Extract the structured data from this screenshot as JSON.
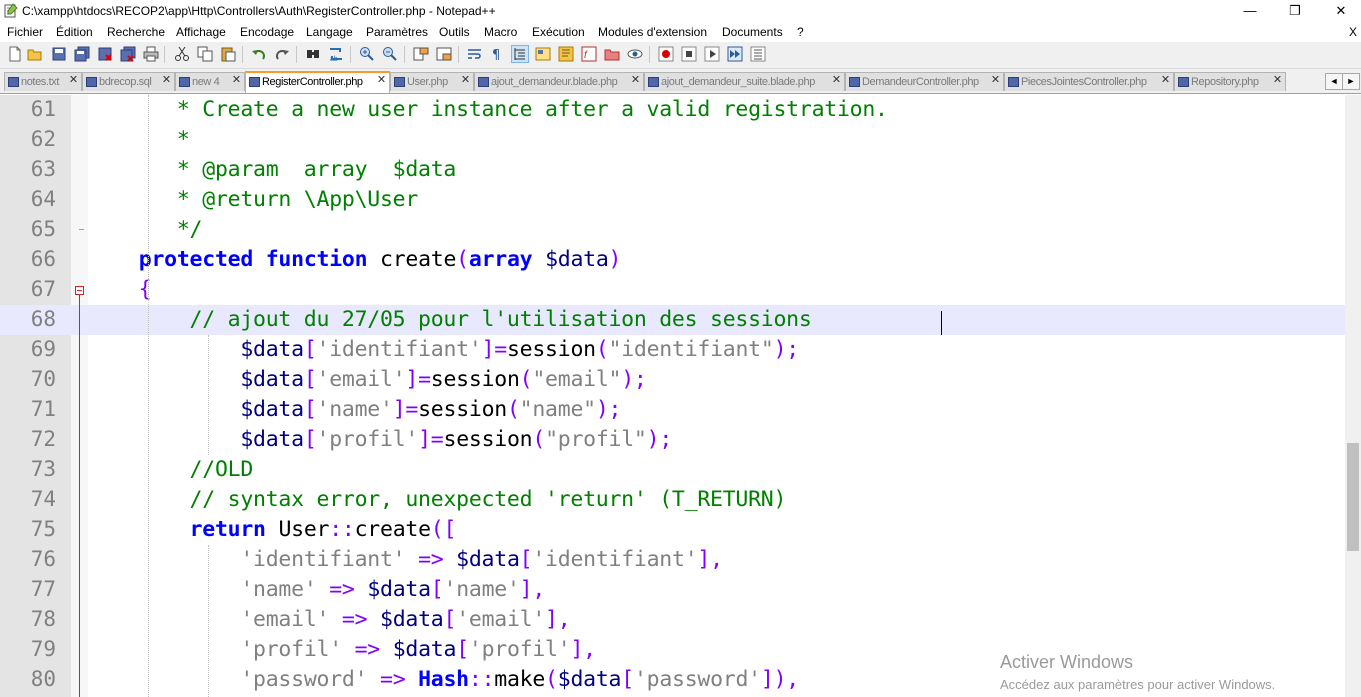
{
  "window": {
    "title": "C:\\xampp\\htdocs\\RECOP2\\app\\Http\\Controllers\\Auth\\RegisterController.php - Notepad++",
    "minimize": "—",
    "maximize": "❐",
    "close": "✕"
  },
  "menu": {
    "items": [
      "Fichier",
      "Édition",
      "Recherche",
      "Affichage",
      "Encodage",
      "Langage",
      "Paramètres",
      "Outils",
      "Macro",
      "Exécution",
      "Modules d'extension",
      "Documents",
      "?"
    ],
    "close_doc": "X"
  },
  "toolbar": {
    "icons": [
      "new-file-icon",
      "open-file-icon",
      "save-icon",
      "save-all-icon",
      "close-icon",
      "close-all-icon",
      "print-icon",
      "cut-icon",
      "copy-icon",
      "paste-icon",
      "undo-icon",
      "redo-icon",
      "find-icon",
      "replace-icon",
      "zoom-in-icon",
      "zoom-out-icon",
      "sync-vertical-icon",
      "sync-horizontal-icon",
      "word-wrap-icon",
      "show-all-chars-icon",
      "indent-guide-icon",
      "lang-udl-icon",
      "doc-map-icon",
      "function-list-icon",
      "folder-workspace-icon",
      "monitoring-icon",
      "record-macro-icon",
      "stop-record-icon",
      "play-macro-icon",
      "run-macro-multiple-icon",
      "save-macro-icon"
    ]
  },
  "tabs": [
    {
      "label": "notes.txt",
      "active": false
    },
    {
      "label": "bdrecop.sql",
      "active": false
    },
    {
      "label": "new 4",
      "active": false
    },
    {
      "label": "RegisterController.php",
      "active": true
    },
    {
      "label": "User.php",
      "active": false
    },
    {
      "label": "ajout_demandeur.blade.php",
      "active": false
    },
    {
      "label": "ajout_demandeur_suite.blade.php",
      "active": false
    },
    {
      "label": "DemandeurController.php",
      "active": false
    },
    {
      "label": "PiecesJointesController.php",
      "active": false
    },
    {
      "label": "Repository.php",
      "active": false
    }
  ],
  "tab_nav": {
    "left": "◄",
    "right": "►"
  },
  "editor": {
    "current_line": 68,
    "lines": [
      {
        "n": "61",
        "code": "       * Create a new user instance after a valid registration."
      },
      {
        "n": "62",
        "code": "       *"
      },
      {
        "n": "63",
        "code": "       * @param  array  $data"
      },
      {
        "n": "64",
        "code": "       * @return \\App\\User"
      },
      {
        "n": "65",
        "code": "       */"
      },
      {
        "n": "66",
        "code": "    protected function create(array $data)"
      },
      {
        "n": "67",
        "code": "    {"
      },
      {
        "n": "68",
        "code": "        // ajout du 27/05 pour l'utilisation des sessions"
      },
      {
        "n": "69",
        "code": "            $data['identifiant']=session(\"identifiant\");"
      },
      {
        "n": "70",
        "code": "            $data['email']=session(\"email\");"
      },
      {
        "n": "71",
        "code": "            $data['name']=session(\"name\");"
      },
      {
        "n": "72",
        "code": "            $data['profil']=session(\"profil\");"
      },
      {
        "n": "73",
        "code": "        //OLD"
      },
      {
        "n": "74",
        "code": "        // syntax error, unexpected 'return' (T_RETURN)"
      },
      {
        "n": "75",
        "code": "        return User::create(["
      },
      {
        "n": "76",
        "code": "            'identifiant' => $data['identifiant'],"
      },
      {
        "n": "77",
        "code": "            'name' => $data['name'],"
      },
      {
        "n": "78",
        "code": "            'email' => $data['email'],"
      },
      {
        "n": "79",
        "code": "            'profil' => $data['profil'],"
      },
      {
        "n": "80",
        "code": "            'password' => Hash::make($data['password']),"
      }
    ]
  },
  "watermark": {
    "title": "Activer Windows",
    "subtitle": "Accédez aux paramètres pour activer Windows."
  },
  "colors": {
    "comment": "#008000",
    "keyword": "#0000ff",
    "variable": "#000080",
    "string": "#808080",
    "operator": "#8000ff",
    "current_line": "#e8e8ff",
    "active_tab_accent": "#fa9a2a"
  }
}
